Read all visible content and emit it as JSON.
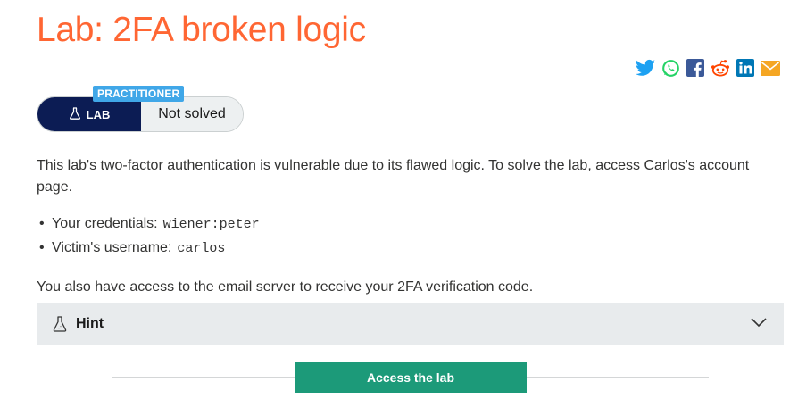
{
  "page": {
    "title": "Lab: 2FA broken logic"
  },
  "share": {
    "icons": [
      "twitter-icon",
      "whatsapp-icon",
      "facebook-icon",
      "reddit-icon",
      "linkedin-icon",
      "email-icon"
    ],
    "colors": {
      "twitter": "#1da1f2",
      "whatsapp": "#25d366",
      "facebook": "#3b5998",
      "reddit": "#ff4500",
      "linkedin": "#0077b5",
      "email": "#f5a623"
    }
  },
  "lab_status": {
    "level": "PRACTITIONER",
    "lab_label": "LAB",
    "status": "Not solved",
    "colors": {
      "level": "#40a7e8",
      "lab": "#0c1c54",
      "status_bg": "#edf0f1"
    }
  },
  "description": "This lab's two-factor authentication is vulnerable due to its flawed logic. To solve the lab, access Carlos's account page.",
  "credentials": {
    "items": [
      {
        "label": "Your credentials:",
        "value": "wiener:peter"
      },
      {
        "label": "Victim's username:",
        "value": "carlos"
      }
    ]
  },
  "email_note": "You also have access to the email server to receive your 2FA verification code.",
  "hint": {
    "label": "Hint"
  },
  "access": {
    "button_label": "Access the lab",
    "color": "#1c9a79"
  },
  "theme": {
    "title_color": "#ff6633"
  }
}
